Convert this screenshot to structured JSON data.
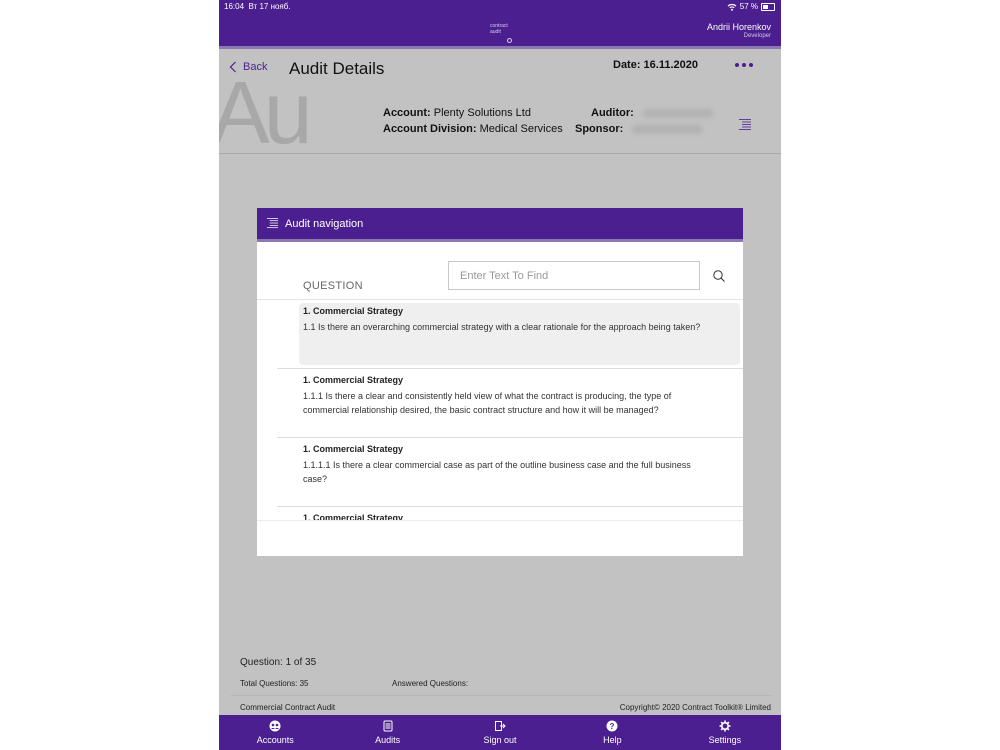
{
  "status_bar": {
    "time": "16:04",
    "date": "Вт 17 нояб.",
    "battery": "57 %",
    "wifi_icon": "wifi-icon",
    "battery_icon": "battery-icon"
  },
  "top_bar": {
    "logo_line1": "contract",
    "logo_line2": "audit",
    "user_name": "Andrii Horenkov",
    "user_role": "Developer"
  },
  "header": {
    "back_label": "Back",
    "title": "Audit Details",
    "watermark": "Au",
    "date_label": "Date: 16.11.2020",
    "account_label": "Account:",
    "account_value": "Plenty Solutions Ltd",
    "division_label": "Account Division:",
    "division_value": "Medical Services",
    "auditor_label": "Auditor:",
    "sponsor_label": "Sponsor:"
  },
  "modal": {
    "title": "Audit navigation",
    "column_header": "QUESTION",
    "search_placeholder": "Enter Text To Find",
    "questions": [
      {
        "section": "1. Commercial Strategy",
        "text": "1.1 Is there an overarching commercial strategy with a clear rationale for the approach being taken?"
      },
      {
        "section": "1. Commercial Strategy",
        "text": "1.1.1 Is there a clear and consistently held view of what the contract is producing, the type of commercial relationship desired, the basic contract structure and how it will be managed?"
      },
      {
        "section": "1. Commercial Strategy",
        "text": "1.1.1.1 Is there a clear commercial case as part of the outline business case and the full business case?"
      },
      {
        "section": "1. Commercial Strategy",
        "text": ""
      }
    ]
  },
  "footer_info": {
    "question_counter": "Question: 1 of 35",
    "total_questions": "Total Questions: 35",
    "answered_questions": "Answered Questions:",
    "app_name": "Commercial Contract Audit",
    "copyright": "Copyright© 2020 Contract Toolkit® Limited"
  },
  "tab_bar": [
    {
      "label": "Accounts",
      "icon": "accounts-icon"
    },
    {
      "label": "Audits",
      "icon": "audits-icon"
    },
    {
      "label": "Sign out",
      "icon": "sign-out-icon"
    },
    {
      "label": "Help",
      "icon": "help-icon"
    },
    {
      "label": "Settings",
      "icon": "settings-icon"
    }
  ],
  "colors": {
    "brand": "#4b1f8f",
    "accent_line": "#8a79b3",
    "backdrop": "#c2c2c2"
  }
}
